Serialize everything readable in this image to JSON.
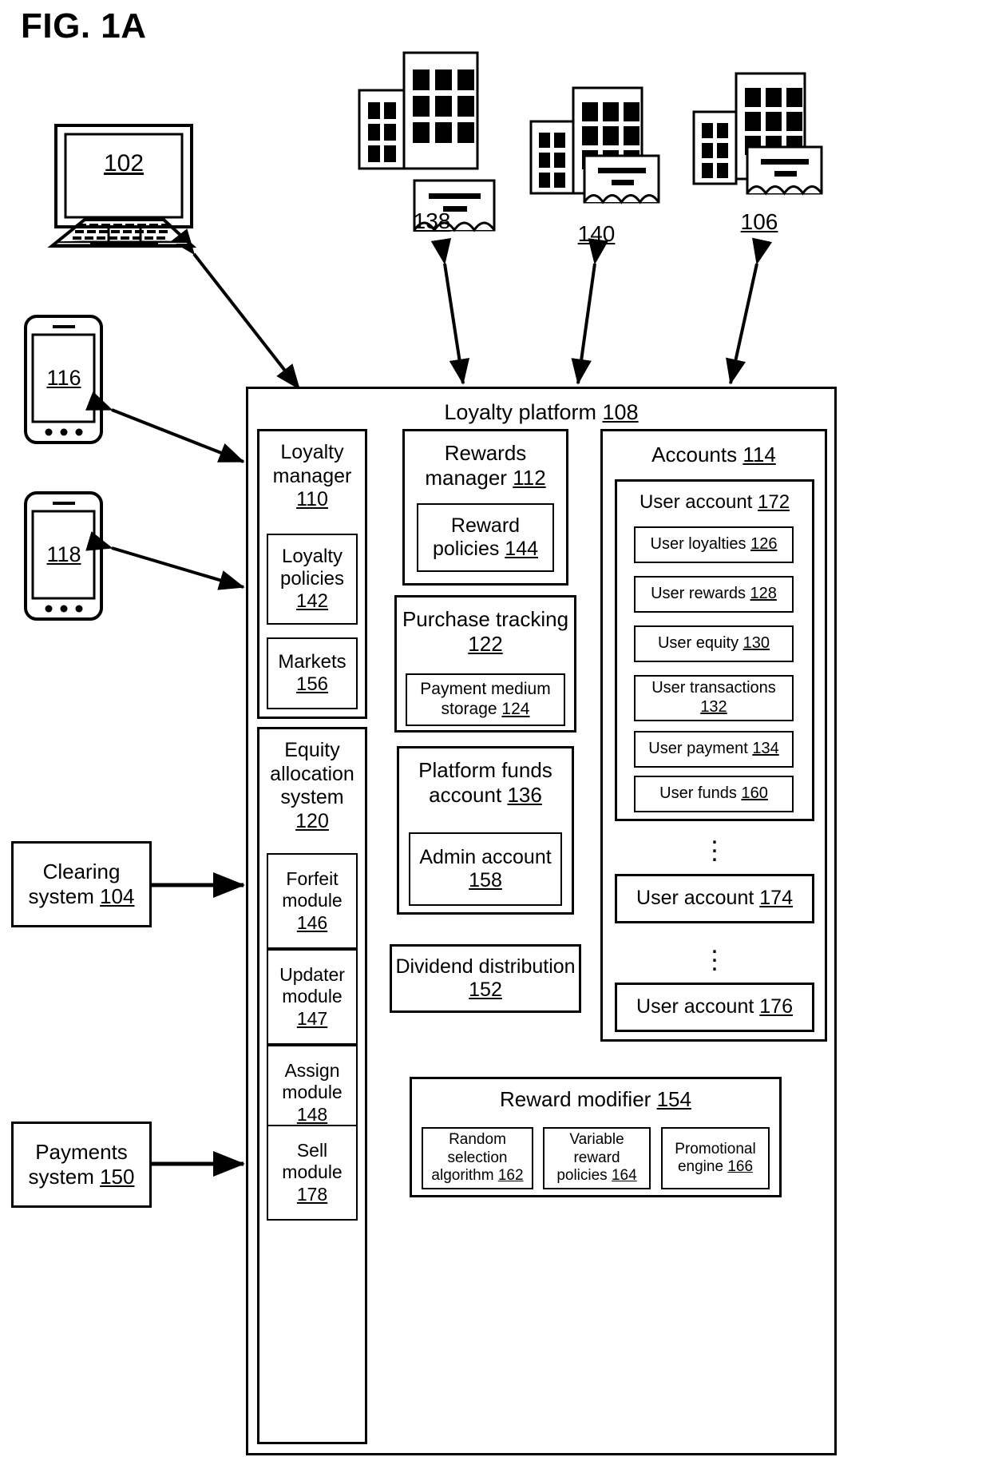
{
  "figure": {
    "title": "FIG. 1A"
  },
  "devices": {
    "desktop": {
      "ref": "102",
      "name": "desktop-computer"
    },
    "phone_1": {
      "ref": "116"
    },
    "phone_2": {
      "ref": "118"
    },
    "merchant_1": {
      "ref": "138"
    },
    "merchant_2": {
      "ref": "140"
    },
    "merchant_3": {
      "ref": "106"
    }
  },
  "external": {
    "clearing_system": {
      "label": "Clearing",
      "label2": "system",
      "ref": "104"
    },
    "payments_system": {
      "label": "Payments",
      "label2": "system",
      "ref": "150"
    }
  },
  "platform": {
    "title": "Loyalty platform",
    "ref": "108",
    "loyalty_manager": {
      "line1": "Loyalty",
      "line2": "manager",
      "ref": "110",
      "children": [
        {
          "line1": "Loyalty",
          "line2": "policies",
          "ref": "142"
        },
        {
          "line1": "Markets",
          "line2": "",
          "ref": "156"
        }
      ]
    },
    "equity_allocation_system": {
      "line1": "Equity",
      "line2": "allocation",
      "line3": "system",
      "ref": "120",
      "children": [
        {
          "line1": "Forfeit",
          "line2": "module",
          "ref": "146"
        },
        {
          "line1": "Updater",
          "line2": "module",
          "ref": "147"
        },
        {
          "line1": "Assign",
          "line2": "module",
          "ref": "148"
        },
        {
          "line1": "Sell",
          "line2": "module",
          "ref": "178"
        }
      ]
    },
    "rewards_manager": {
      "line1": "Rewards",
      "line2": "manager",
      "ref": "112",
      "children": [
        {
          "line1": "Reward",
          "line2": "policies",
          "ref": "144"
        }
      ]
    },
    "purchase_tracking": {
      "line1": "Purchase tracking",
      "ref": "122",
      "children": [
        {
          "line1": "Payment medium",
          "line2": "storage",
          "ref": "124"
        }
      ]
    },
    "platform_funds_account": {
      "line1": "Platform funds",
      "line2": "account",
      "ref": "136",
      "children": [
        {
          "line1": "Admin account",
          "ref": "158"
        }
      ]
    },
    "dividend_distribution": {
      "line1": "Dividend distribution",
      "ref": "152"
    },
    "accounts": {
      "title": "Accounts",
      "ref": "114",
      "user_account": {
        "title": "User account",
        "ref": "172",
        "items": [
          {
            "label": "User loyalties",
            "ref": "126"
          },
          {
            "label": "User rewards",
            "ref": "128"
          },
          {
            "label": "User equity",
            "ref": "130"
          },
          {
            "label": "User transactions",
            "ref": "132"
          },
          {
            "label": "User payment",
            "ref": "134"
          },
          {
            "label": "User funds",
            "ref": "160"
          }
        ]
      },
      "other_accounts": [
        {
          "title": "User account",
          "ref": "174"
        },
        {
          "title": "User account",
          "ref": "176"
        }
      ]
    },
    "reward_modifier": {
      "title": "Reward modifier",
      "ref": "154",
      "children": [
        {
          "line1": "Random",
          "line2": "selection",
          "line3": "algorithm",
          "ref": "162"
        },
        {
          "line1": "Variable",
          "line2": "reward",
          "line3": "policies",
          "ref": "164"
        },
        {
          "line1": "Promotional",
          "line2": "engine",
          "ref": "166"
        }
      ]
    }
  },
  "colors": {
    "stroke": "#000000",
    "background": "#ffffff"
  }
}
